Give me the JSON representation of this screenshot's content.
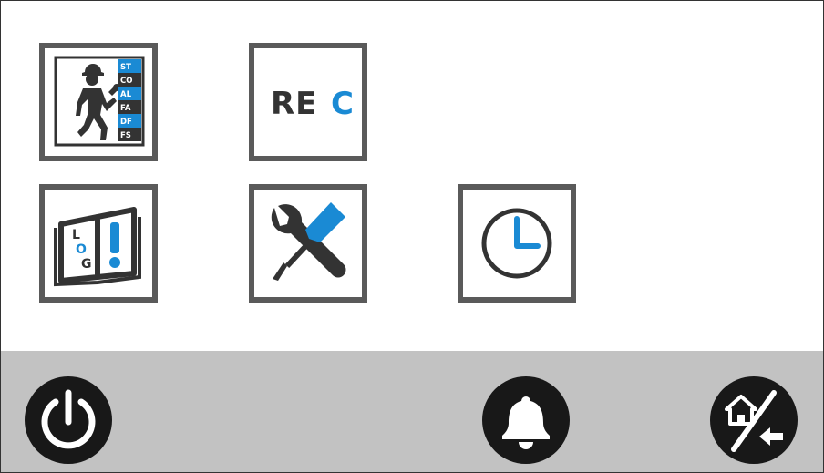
{
  "tiles": {
    "service": {
      "codes": [
        "ST",
        "CO",
        "AL",
        "FA",
        "DF",
        "FS"
      ]
    },
    "rec": {
      "label_part1": "RE",
      "label_part2": "C"
    },
    "log": {
      "letters": [
        "L",
        "O",
        "G"
      ]
    }
  },
  "colors": {
    "accent": "#1a8ad4",
    "icon_dark": "#333333",
    "frame": "#5a5a5a",
    "bar": "#c2c2c2"
  },
  "icons": {
    "service": "service-technician-icon",
    "rec": "rec-icon",
    "log": "log-book-icon",
    "tools": "wrench-screwdriver-icon",
    "clock": "clock-icon",
    "power": "power-icon",
    "alarm": "bell-icon",
    "home_switch": "home-switch-icon"
  }
}
